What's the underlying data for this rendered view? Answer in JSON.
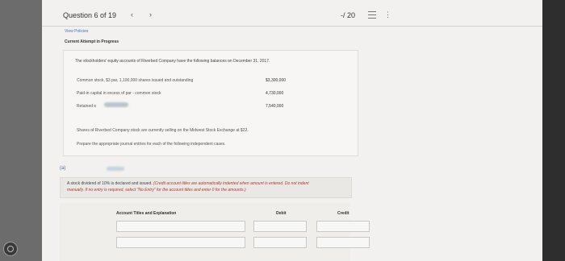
{
  "header": {
    "question_label": "Question 6 of 19",
    "prev_icon": "‹",
    "next_icon": "›",
    "score": "-/ 20",
    "list_icon": "list-icon",
    "more_icon": "⋮"
  },
  "links": {
    "view_policies": "View Policies"
  },
  "attempt_label": "Current Attempt in Progress",
  "problem": {
    "intro": "The stockholders' equity accounts of Riverbed Company have the following balances on December 31, 2017.",
    "rows": [
      {
        "label": "Common stock, $3 par, 1,100,000 shares issued and outstanding",
        "value": "$3,300,000"
      },
      {
        "label": "Paid-in capital in excess of par - common stock",
        "value": "4,730,000"
      },
      {
        "label": "Retained e",
        "value": "7,540,000"
      }
    ],
    "market": "Shares of Riverbed Company stock are currently selling on the Midwest Stock Exchange at $22.",
    "prepare": "Prepare the appropriate journal entries for each of the following independent cases."
  },
  "part_a": {
    "label": "(a)",
    "instruction_main": "A stock dividend of 10% is declared and issued.",
    "instruction_red1": "(Credit account titles are automatically indented when amount is entered. Do not indent",
    "instruction_red2": "manually. If no entry is required, select \"No Entry\" for the account titles and enter 0 for the amounts.)"
  },
  "table": {
    "headers": {
      "account": "Account Titles and Explanation",
      "debit": "Debit",
      "credit": "Credit"
    }
  }
}
